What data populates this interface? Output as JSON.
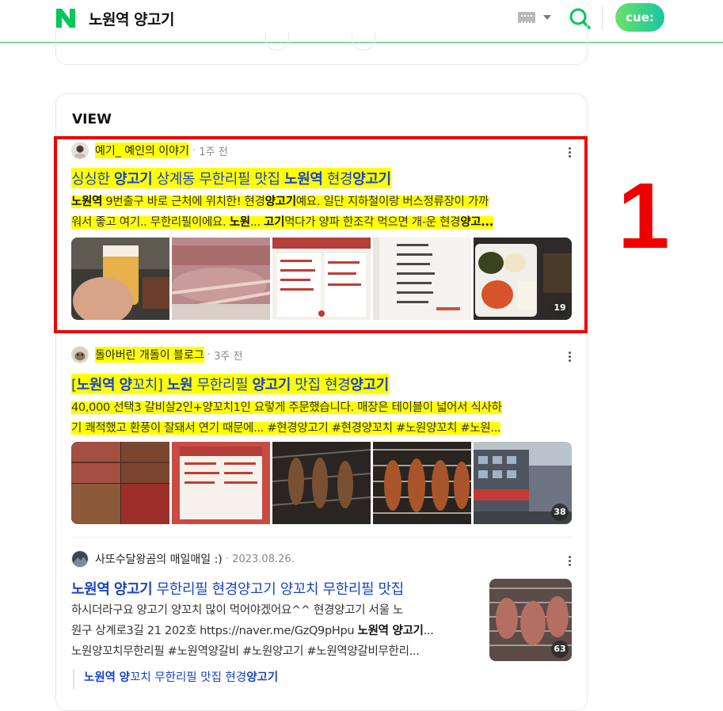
{
  "header": {
    "logo": "N",
    "query": "노원역 양고기",
    "cue_label": "cue:",
    "colors": {
      "brand_green": "#03c75a",
      "link_blue": "#1a43c7",
      "highlight": "#ffff00",
      "annotation_red": "#ee0000"
    }
  },
  "view": {
    "title": "VIEW"
  },
  "annotation": {
    "label": "1"
  },
  "posts": [
    {
      "author": "예기_ 예인의 이야기",
      "time": "1주 전",
      "title_parts": [
        "싱싱한 ",
        "양고기",
        " 상계동 무한리필 맛집 ",
        "노원역",
        " 현경",
        "양고기"
      ],
      "desc_line1": [
        "노원역",
        " 9번출구 바로 근처에 위치한! 현경",
        "양고기",
        "예요. 일단 지하철이랑 버스정류장이 가까"
      ],
      "desc_line2": [
        "워서 좋고 여기.. 무한리필이에요. ",
        "노원",
        "... ",
        "고기",
        "먹다가 양파 한조각 먹으면 개-운 현경",
        "양고..."
      ],
      "photo_count": "19"
    },
    {
      "author": "돌아버린 개돌이 블로그",
      "time": "3주 전",
      "title_parts": [
        "[",
        "노원역",
        " ",
        "양",
        "꼬치] ",
        "노원",
        " 무한리필 ",
        "양고기",
        " 맛집 현경",
        "양고기"
      ],
      "desc_line1": "40,000 선택3 갈비살2인+양꼬치1인 요렇게 주문했습니다. 매장은 테이블이 넓어서 식사하",
      "desc_line2": "기 쾌적했고 환풍이 잘돼서 연기 때문에... #현경양고기 #현경양꼬치 #노원양꼬치 #노원...",
      "photo_count": "38"
    },
    {
      "author": "사또수달왕곰의 매일매일 :)",
      "time": "2023.08.26.",
      "title_parts": [
        "노원역",
        " ",
        "양고기",
        " 무한리필 현경양고기 양꼬치 무한리필 맛집"
      ],
      "desc_line1": "하시더라구요 양고기 양꼬치 많이 먹어야겠어요^^ 현경양고기 서울 노",
      "desc_line2": [
        "원구 상계로3길 21 202호 https://naver.me/GzQ9pHpu ",
        "노원역 양고기",
        "..."
      ],
      "desc_line3": "노원양꼬치무한리필 #노원역양갈비 #노원양고기 #노원역양갈비무한리...",
      "photo_count": "63",
      "sub_link_parts": [
        "노원역",
        " ",
        "양",
        "꼬치 무한리필 맛집 현경",
        "양고기"
      ]
    }
  ]
}
